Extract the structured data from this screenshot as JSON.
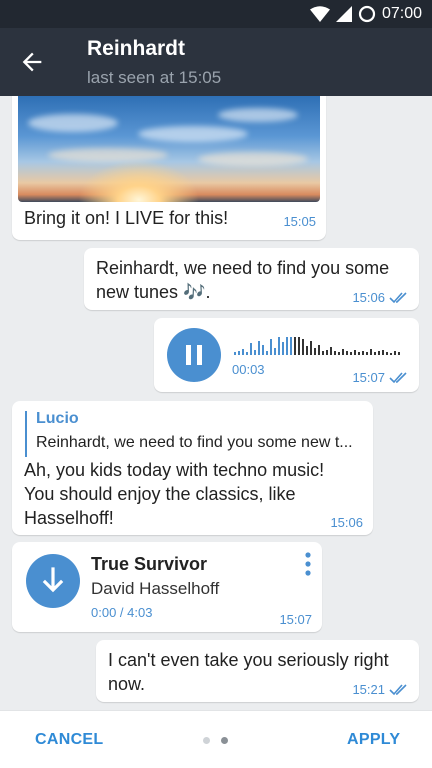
{
  "status_bar": {
    "time": "07:00"
  },
  "header": {
    "title": "Reinhardt",
    "subtitle": "last seen at 15:05"
  },
  "messages": [
    {
      "kind": "photo",
      "side": "incoming",
      "text": "Bring it on! I LIVE for this!",
      "time": "15:05"
    },
    {
      "kind": "text",
      "side": "outgoing",
      "line1": "Reinhardt, we need to find you some",
      "line2": "new tunes 🎶.",
      "time": "15:06",
      "read": true
    },
    {
      "kind": "voice",
      "side": "outgoing",
      "duration": "00:03",
      "time": "15:07",
      "read": true,
      "progress": 0.35
    },
    {
      "kind": "reply",
      "side": "incoming",
      "reply_author": "Lucio",
      "reply_text": "Reinhardt, we need to find you some new t...",
      "lines": [
        "Ah, you kids today with techno music!",
        "You should enjoy the classics, like",
        "Hasselhoff!"
      ],
      "time": "15:06"
    },
    {
      "kind": "audio",
      "side": "incoming",
      "track_title": "True Survivor",
      "artist": "David Hasselhoff",
      "progress_text": "0:00 / 4:03",
      "time": "15:07"
    },
    {
      "kind": "text",
      "side": "outgoing",
      "line1": "I can't even take you seriously right",
      "line2": "now.",
      "time": "15:21",
      "read": true
    }
  ],
  "bottom_bar": {
    "cancel_label": "CANCEL",
    "apply_label": "APPLY",
    "page_count": 2,
    "active_page": 2
  },
  "colors": {
    "accent": "#4a8fd0",
    "header_bg": "#2c333e",
    "status_bg": "#222831",
    "chat_bg": "#ebedef",
    "button_text": "#2f8ad6"
  },
  "icons": [
    "wifi-icon",
    "signal-icon",
    "battery-icon",
    "back-arrow-icon",
    "double-check-icon",
    "pause-icon",
    "download-icon",
    "more-vert-icon"
  ]
}
